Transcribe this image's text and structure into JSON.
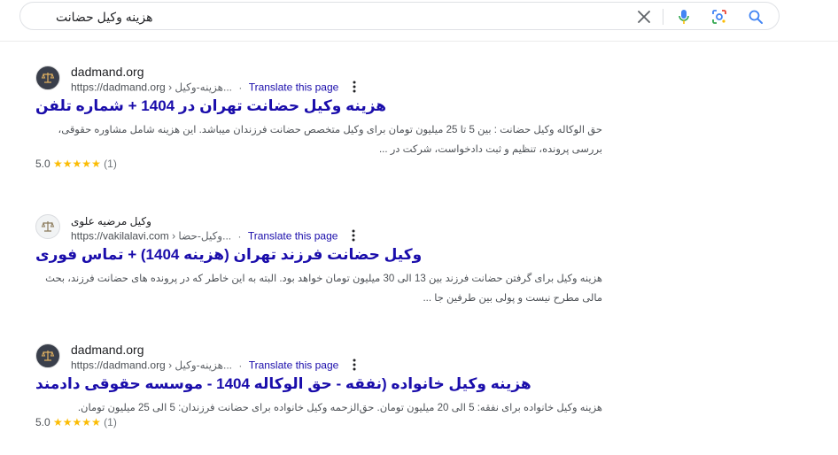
{
  "search": {
    "query": "هزینه وکیل حضانت"
  },
  "results": [
    {
      "site_name": "dadmand.org",
      "url": "https://dadmand.org",
      "path": "› هزینه-وکیل...",
      "translate": "Translate this page",
      "title": "هزینه وکیل حضانت تهران در 1404 + شماره تلفن",
      "snippet": "حق الوکاله وکیل حضانت : بین 5 تا 25 میلیون تومان برای وکیل متخصص حضانت فرزندان میباشد. این هزینه شامل مشاوره حقوقی، بررسی پرونده، تنظیم و ثبت دادخواست، شرکت در ...",
      "rating": "5.0",
      "stars": "★★★★★",
      "reviews": "(1)"
    },
    {
      "site_name": "وکیل مرضیه علوی",
      "url": "https://vakilalavi.com",
      "path": "› وکیل-حضا...",
      "translate": "Translate this page",
      "title": "وکیل حضانت فرزند تهران (هزینه 1404) + تماس فوری",
      "snippet": "هزینه وکیل برای گرفتن حضانت فرزند بین 13 الی 30 میلیون تومان خواهد بود. البته به این خاطر که در پرونده های حضانت فرزند، بحث مالی مطرح نیست و پولی بین طرفین جا ..."
    },
    {
      "site_name": "dadmand.org",
      "url": "https://dadmand.org",
      "path": "› هزینه-وکیل...",
      "translate": "Translate this page",
      "title": "هزینه وکیل خانواده (نفقه - حق الوکاله 1404 - موسسه حقوقی دادمند",
      "snippet": "هزینه وکیل خانواده برای نفقه: 5 الی 20 میلیون تومان. حق‌الزحمه وکیل خانواده برای حضانت فرزندان: 5 الی 25 میلیون تومان.",
      "rating": "5.0",
      "stars": "★★★★★",
      "reviews": "(1)"
    }
  ],
  "colors": {
    "link": "#1a0dab",
    "star": "#fbbc04",
    "text": "#4d5156"
  },
  "icons": {
    "clear": "close-icon",
    "mic": "microphone-icon",
    "lens": "camera-lens-icon",
    "search": "search-icon",
    "more": "more-vertical-icon",
    "favicon": "scales-icon"
  }
}
